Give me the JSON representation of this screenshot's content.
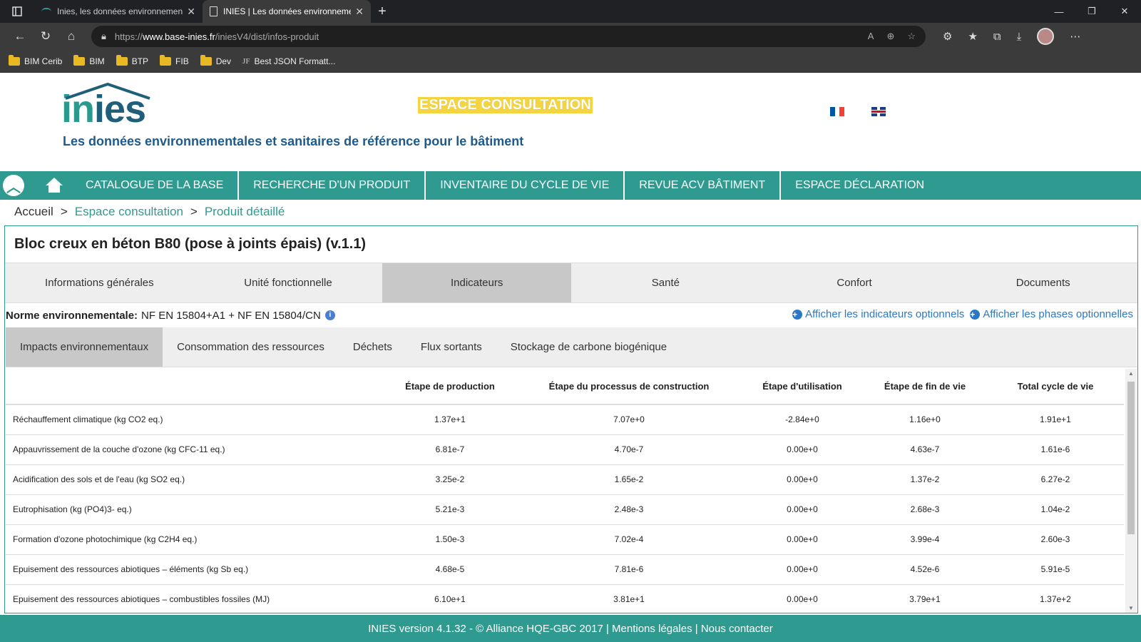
{
  "browser": {
    "tabs": [
      {
        "title": "Inies, les données environnemen",
        "active": false
      },
      {
        "title": "INIES | Les données environneme",
        "active": true
      }
    ],
    "url_prefix": "https://",
    "url_host": "www.base-inies.fr",
    "url_path": "/iniesV4/dist/infos-produit",
    "bookmarks": [
      "BIM Cerib",
      "BIM",
      "BTP",
      "FIB",
      "Dev"
    ],
    "bookmark_jf": "Best JSON Formatt..."
  },
  "header": {
    "logo_a": "in",
    "logo_b": "ies",
    "tagline": "Les données environnementales et sanitaires de référence pour le bâtiment",
    "espace": "ESPACE CONSULTATION"
  },
  "nav": {
    "items": [
      "CATALOGUE DE LA BASE",
      "RECHERCHE D'UN PRODUIT",
      "INVENTAIRE DU CYCLE DE VIE",
      "REVUE ACV BÂTIMENT",
      "ESPACE DÉCLARATION"
    ]
  },
  "breadcrumb": {
    "home": "Accueil",
    "sep": ">",
    "level1": "Espace consultation",
    "level2": "Produit détaillé"
  },
  "product": {
    "title": "Bloc creux en béton B80 (pose à joints épais) (v.1.1)",
    "tabs": [
      "Informations générales",
      "Unité fonctionnelle",
      "Indicateurs",
      "Santé",
      "Confort",
      "Documents"
    ],
    "active_tab": "Indicateurs",
    "norm_label": "Norme environnementale:",
    "norm_value": "NF EN 15804+A1 + NF EN 15804/CN",
    "opt_indicators": "Afficher les indicateurs optionnels",
    "opt_phases": "Afficher les phases optionnelles",
    "subtabs": [
      "Impacts environnementaux",
      "Consommation des ressources",
      "Déchets",
      "Flux sortants",
      "Stockage de carbone biogénique"
    ],
    "active_subtab": "Impacts environnementaux"
  },
  "table": {
    "headers": [
      "",
      "Étape de production",
      "Étape du processus de construction",
      "Étape d'utilisation",
      "Étape de fin de vie",
      "Total cycle de vie"
    ],
    "rows": [
      [
        "Réchauffement climatique (kg CO2 eq.)",
        "1.37e+1",
        "7.07e+0",
        "-2.84e+0",
        "1.16e+0",
        "1.91e+1"
      ],
      [
        "Appauvrissement de la couche d'ozone (kg CFC-11 eq.)",
        "6.81e-7",
        "4.70e-7",
        "0.00e+0",
        "4.63e-7",
        "1.61e-6"
      ],
      [
        "Acidification des sols et de l'eau (kg SO2 eq.)",
        "3.25e-2",
        "1.65e-2",
        "0.00e+0",
        "1.37e-2",
        "6.27e-2"
      ],
      [
        "Eutrophisation (kg (PO4)3- eq.)",
        "5.21e-3",
        "2.48e-3",
        "0.00e+0",
        "2.68e-3",
        "1.04e-2"
      ],
      [
        "Formation d'ozone photochimique (kg C2H4 eq.)",
        "1.50e-3",
        "7.02e-4",
        "0.00e+0",
        "3.99e-4",
        "2.60e-3"
      ],
      [
        "Epuisement des ressources abiotiques – éléments (kg Sb eq.)",
        "4.68e-5",
        "7.81e-6",
        "0.00e+0",
        "4.52e-6",
        "5.91e-5"
      ],
      [
        "Epuisement des ressources abiotiques – combustibles fossiles (MJ)",
        "6.10e+1",
        "3.81e+1",
        "0.00e+0",
        "3.79e+1",
        "1.37e+2"
      ]
    ]
  },
  "footer": {
    "version": "INIES version 4.1.32",
    "copyright": " - © Alliance HQE-GBC 2017 ",
    "legal": "| Mentions légales ",
    "contact": "| Nous contacter"
  },
  "colors": {
    "teal": "#2f9a90",
    "espace_bg": "#f5d442",
    "link_blue": "#2a78c5"
  }
}
